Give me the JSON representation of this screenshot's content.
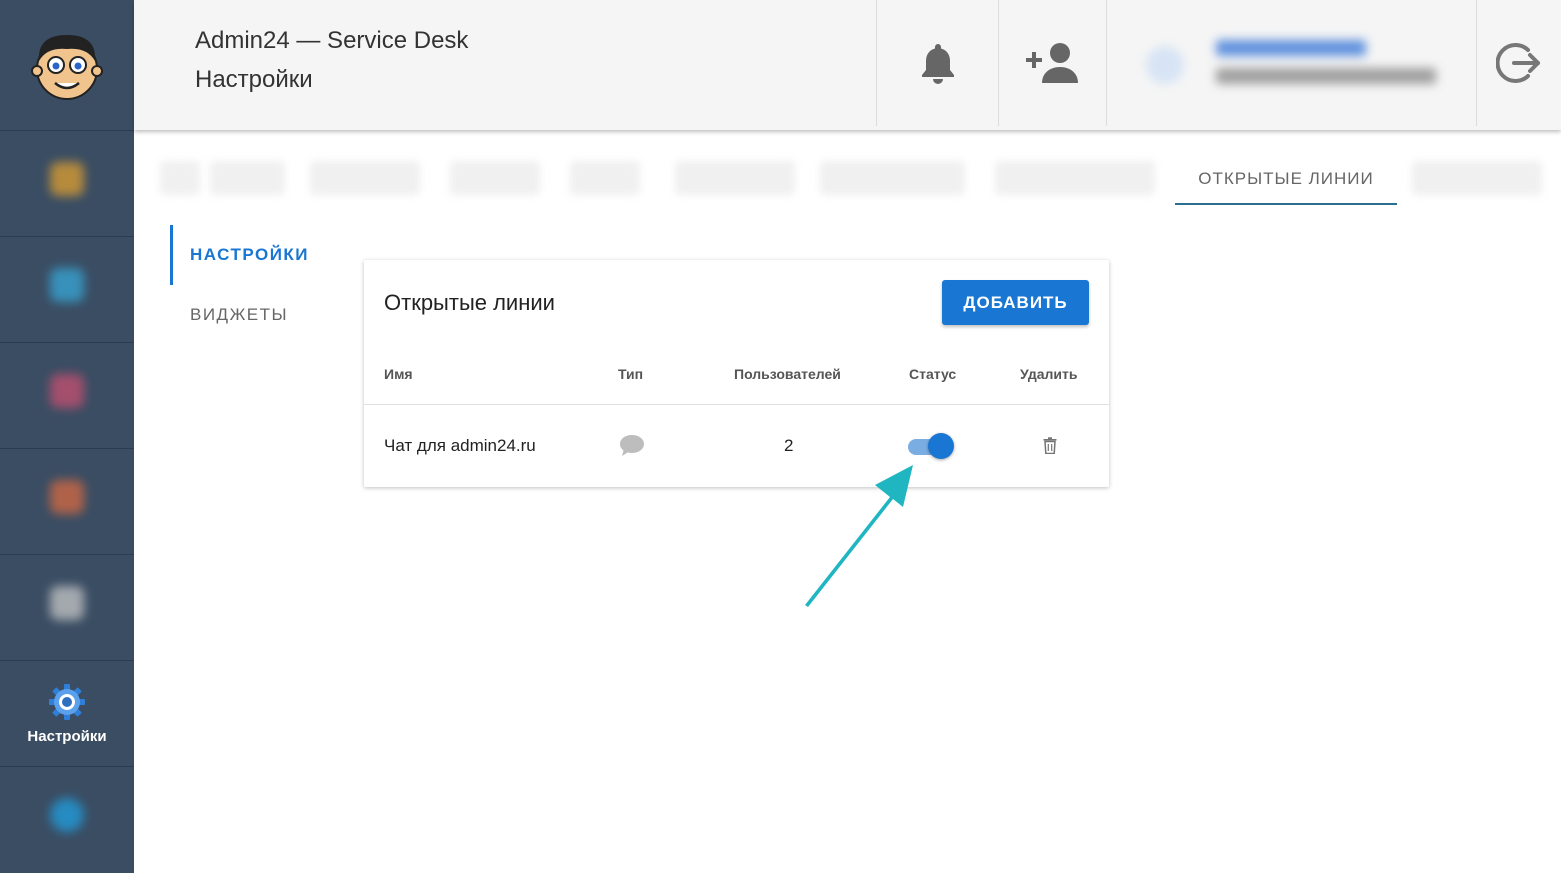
{
  "header": {
    "title": "Admin24 — Service Desk",
    "subtitle": "Настройки"
  },
  "sidebar": {
    "active_label": "Настройки",
    "items": [
      "",
      "",
      "",
      "",
      ""
    ]
  },
  "tabs": {
    "active": "ОТКРЫТЫЕ ЛИНИИ"
  },
  "subnav": {
    "settings": "НАСТРОЙКИ",
    "widgets": "ВИДЖЕТЫ"
  },
  "card": {
    "title": "Открытые линии",
    "add_button": "ДОБАВИТЬ",
    "columns": {
      "name": "Имя",
      "type": "Тип",
      "users": "Пользователей",
      "status": "Статус",
      "delete": "Удалить"
    },
    "rows": [
      {
        "name": "Чат для admin24.ru",
        "type_icon": "chat-bubble-icon",
        "users": "2",
        "status_on": true
      }
    ]
  },
  "colors": {
    "sidebar": "#3a4d63",
    "accent": "#1976d2",
    "arrow": "#1fb6c1"
  }
}
